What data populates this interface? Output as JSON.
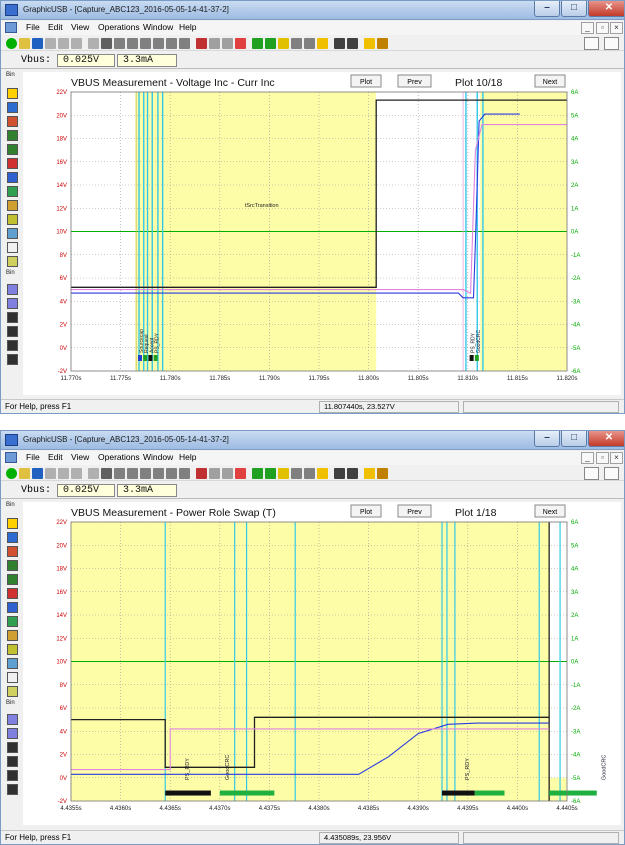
{
  "colors": {
    "plot_bg": "#fdfda8",
    "grid": "#9a9a9a",
    "voltage": "#202020",
    "current_blue": "#2a3ae0",
    "pink": "#e084e0",
    "green_ref": "#00b000",
    "cyan": "#33c8e8",
    "volt_axis": "#cc0000",
    "curr_axis": "#00aa00"
  },
  "windows": [
    {
      "title": "GraphicUSB - [Capture_ABC123_2016-05-05-14-41-37-2]",
      "menu": [
        "File",
        "Edit",
        "View",
        "Operations",
        "Window",
        "Help"
      ],
      "vbus_label": "Vbus:",
      "vbus_voltage": "0.025V",
      "vbus_current": "3.3mA",
      "plot_title": "VBUS Measurement - Voltage Inc - Curr Inc",
      "btn_plot": "Plot",
      "btn_prev": "Prev",
      "btn_next": "Next",
      "plot_counter": "Plot 10/18",
      "status_help": "For Help, press F1",
      "status_cursor": "11.807440s, 23.527V",
      "side_top": "Bin",
      "side_mid": "Bin",
      "annotation": "tSrcTransition",
      "marker_labels_left": [
        "Sourcecap",
        "Request",
        "Accept",
        "PS_RDY"
      ],
      "marker_labels_right": [
        "PS_RDY",
        "GoodCRC"
      ],
      "chart_data": {
        "type": "line",
        "title": "VBUS Measurement - Voltage Inc - Curr Inc",
        "x_ticks": [
          "11.770s",
          "11.775s",
          "11.780s",
          "11.785s",
          "11.790s",
          "11.795s",
          "11.800s",
          "11.805s",
          "11.810s",
          "11.815s",
          "11.820s"
        ],
        "y_left_ticks": [
          "22V",
          "20V",
          "18V",
          "16V",
          "14V",
          "12V",
          "10V",
          "8V",
          "6V",
          "4V",
          "2V",
          "0V",
          "-2V"
        ],
        "y_right_ticks": [
          "6A",
          "5A",
          "4A",
          "3A",
          "2A",
          "1A",
          "0A",
          "-1A",
          "-2A",
          "-3A",
          "-4A",
          "-5A",
          "-6A"
        ],
        "xlim": [
          11.768,
          11.8205
        ],
        "ylim": [
          -2,
          22
        ],
        "grid": true,
        "series": [
          {
            "axis": "left",
            "color": "#202020",
            "points": [
              [
                11.768,
                5.2
              ],
              [
                11.8003,
                5.2
              ],
              [
                11.8003,
                21.3
              ],
              [
                11.8205,
                21.3
              ]
            ]
          },
          {
            "axis": "left",
            "color": "#2a3ae0",
            "points": [
              [
                11.768,
                4.7
              ],
              [
                11.809,
                4.7
              ],
              [
                11.8095,
                4.3
              ],
              [
                11.8106,
                4.3
              ],
              [
                11.8108,
                9
              ],
              [
                11.8112,
                19.5
              ],
              [
                11.8118,
                20.1
              ],
              [
                11.8155,
                20.1
              ]
            ]
          },
          {
            "axis": "left",
            "color": "#e084e0",
            "points": [
              [
                11.768,
                5.0
              ],
              [
                11.8095,
                5.0
              ],
              [
                11.8103,
                4.7
              ],
              [
                11.8108,
                17
              ],
              [
                11.8115,
                19.2
              ],
              [
                11.8205,
                19.2
              ]
            ]
          }
        ]
      }
    },
    {
      "title": "GraphicUSB - [Capture_ABC123_2016-05-05-14-41-37-2]",
      "menu": [
        "File",
        "Edit",
        "View",
        "Operations",
        "Window",
        "Help"
      ],
      "vbus_label": "Vbus:",
      "vbus_voltage": "0.025V",
      "vbus_current": "3.3mA",
      "plot_title": "VBUS Measurement - Power Role Swap (T)",
      "btn_plot": "Plot",
      "btn_prev": "Prev",
      "btn_next": "Next",
      "plot_counter": "Plot 1/18",
      "status_help": "For Help, press F1",
      "status_cursor": "4.435089s, 23.956V",
      "side_top": "Bin",
      "side_mid": "Bin",
      "marker_labels": [
        "PS_RDY",
        "GoodCRC",
        "PS_RDY",
        "GoodCRC"
      ],
      "chart_data": {
        "type": "line",
        "title": "VBUS Measurement - Power Role Swap (T)",
        "x_ticks": [
          "4.4355s",
          "4.4360s",
          "4.4365s",
          "4.4370s",
          "4.4375s",
          "4.4380s",
          "4.4385s",
          "4.4390s",
          "4.4395s",
          "4.4400s",
          "4.4405s"
        ],
        "y_left_ticks": [
          "22V",
          "20V",
          "18V",
          "16V",
          "14V",
          "12V",
          "10V",
          "8V",
          "6V",
          "4V",
          "2V",
          "0V",
          "-2V"
        ],
        "y_right_ticks": [
          "6A",
          "5A",
          "4A",
          "3A",
          "2A",
          "1A",
          "0A",
          "-1A",
          "-2A",
          "-3A",
          "-4A",
          "-5A",
          "-6A"
        ],
        "xlim": [
          4.4355,
          4.4405
        ],
        "ylim": [
          -2,
          22
        ],
        "grid": true,
        "series": [
          {
            "axis": "left",
            "color": "#202020",
            "points": [
              [
                4.4355,
                5.0
              ],
              [
                4.43645,
                5.0
              ],
              [
                4.43645,
                0.9
              ],
              [
                4.43735,
                0.9
              ],
              [
                4.43735,
                5.2
              ],
              [
                4.44032,
                5.2
              ]
            ]
          },
          {
            "axis": "left",
            "color": "#2a3ae0",
            "points": [
              [
                4.4355,
                0.3
              ],
              [
                4.4384,
                0.3
              ],
              [
                4.4387,
                1.8
              ],
              [
                4.439,
                3.8
              ],
              [
                4.4393,
                4.6
              ],
              [
                4.4396,
                4.7
              ],
              [
                4.44032,
                4.7
              ]
            ]
          },
          {
            "axis": "left",
            "color": "#e084e0",
            "points": [
              [
                4.4355,
                0.7
              ],
              [
                4.4365,
                0.7
              ],
              [
                4.4365,
                4.2
              ],
              [
                4.44032,
                4.2
              ]
            ]
          }
        ]
      }
    }
  ]
}
